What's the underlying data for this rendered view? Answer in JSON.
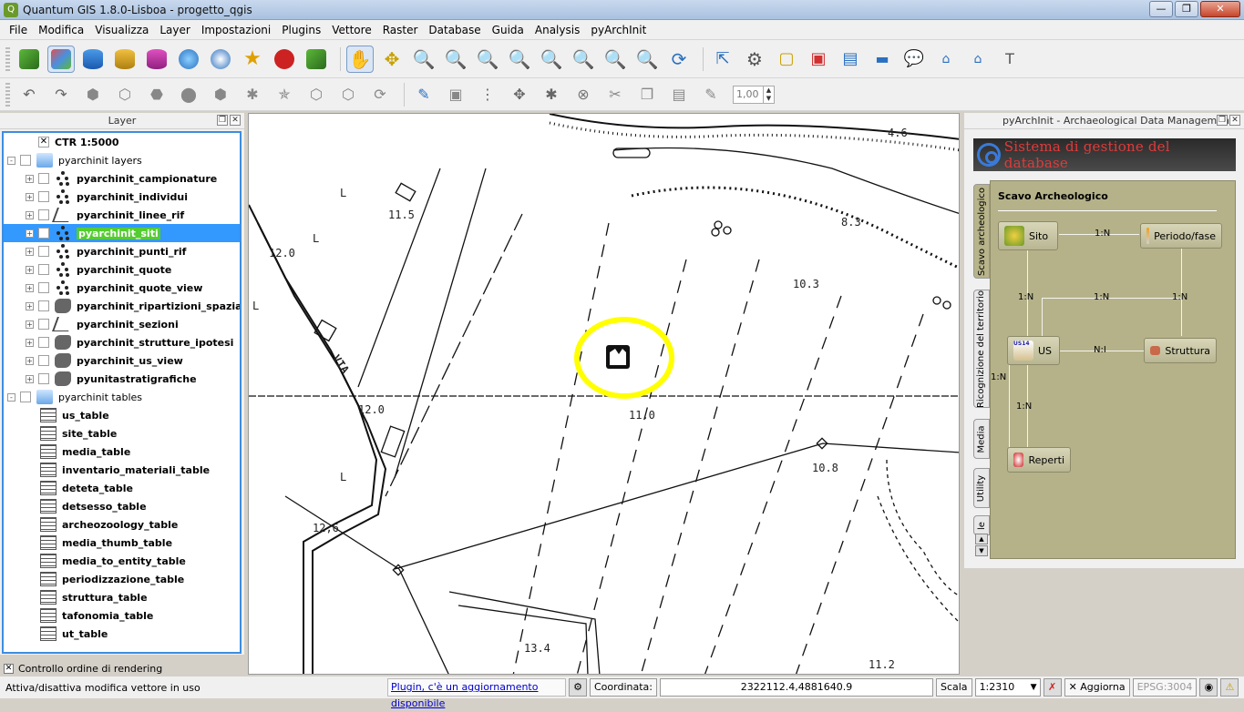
{
  "window": {
    "title": "Quantum GIS 1.8.0-Lisboa - progetto_qgis",
    "icon_label": "Q"
  },
  "menu": [
    "File",
    "Modifica",
    "Visualizza",
    "Layer",
    "Impostazioni",
    "Plugins",
    "Vettore",
    "Raster",
    "Database",
    "Guida",
    "Analysis",
    "pyArchInit"
  ],
  "layer_panel": {
    "title": "Layer",
    "rows": [
      {
        "label": "CTR 1:5000",
        "checked": true,
        "indent": 1,
        "icon": "none",
        "expander": "",
        "checkbox": true,
        "bold": true
      },
      {
        "label": "pyarchinit layers",
        "checked": false,
        "indent": 0,
        "icon": "folder",
        "expander": "-",
        "checkbox": true,
        "bold": false
      },
      {
        "label": "pyarchinit_campionature",
        "checked": false,
        "indent": 1,
        "icon": "points",
        "expander": "+",
        "checkbox": true,
        "bold": true
      },
      {
        "label": "pyarchinit_individui",
        "checked": false,
        "indent": 1,
        "icon": "points",
        "expander": "+",
        "checkbox": true,
        "bold": true
      },
      {
        "label": "pyarchinit_linee_rif",
        "checked": false,
        "indent": 1,
        "icon": "lines",
        "expander": "+",
        "checkbox": true,
        "bold": true
      },
      {
        "label": "pyarchinit_siti",
        "checked": true,
        "indent": 1,
        "icon": "points",
        "expander": "+",
        "checkbox": true,
        "bold": true,
        "selected": true
      },
      {
        "label": "pyarchinit_punti_rif",
        "checked": false,
        "indent": 1,
        "icon": "points",
        "expander": "+",
        "checkbox": true,
        "bold": true
      },
      {
        "label": "pyarchinit_quote",
        "checked": false,
        "indent": 1,
        "icon": "points",
        "expander": "+",
        "checkbox": true,
        "bold": true
      },
      {
        "label": "pyarchinit_quote_view",
        "checked": false,
        "indent": 1,
        "icon": "points",
        "expander": "+",
        "checkbox": true,
        "bold": true
      },
      {
        "label": "pyarchinit_ripartizioni_spaziali",
        "checked": false,
        "indent": 1,
        "icon": "polygon",
        "expander": "+",
        "checkbox": true,
        "bold": true
      },
      {
        "label": "pyarchinit_sezioni",
        "checked": false,
        "indent": 1,
        "icon": "lines",
        "expander": "+",
        "checkbox": true,
        "bold": true
      },
      {
        "label": "pyarchinit_strutture_ipotesi",
        "checked": false,
        "indent": 1,
        "icon": "polygon",
        "expander": "+",
        "checkbox": true,
        "bold": true
      },
      {
        "label": "pyarchinit_us_view",
        "checked": false,
        "indent": 1,
        "icon": "polygon",
        "expander": "+",
        "checkbox": true,
        "bold": true
      },
      {
        "label": "pyunitastratigrafiche",
        "checked": false,
        "indent": 1,
        "icon": "polygon",
        "expander": "+",
        "checkbox": true,
        "bold": true
      },
      {
        "label": "pyarchinit tables",
        "checked": false,
        "indent": 0,
        "icon": "folder",
        "expander": "-",
        "checkbox": true,
        "bold": false
      },
      {
        "label": "us_table",
        "indent": 2,
        "icon": "table",
        "expander": "",
        "checkbox": false,
        "bold": true
      },
      {
        "label": "site_table",
        "indent": 2,
        "icon": "table",
        "expander": "",
        "checkbox": false,
        "bold": true
      },
      {
        "label": "media_table",
        "indent": 2,
        "icon": "table",
        "expander": "",
        "checkbox": false,
        "bold": true
      },
      {
        "label": "inventario_materiali_table",
        "indent": 2,
        "icon": "table",
        "expander": "",
        "checkbox": false,
        "bold": true
      },
      {
        "label": "deteta_table",
        "indent": 2,
        "icon": "table",
        "expander": "",
        "checkbox": false,
        "bold": true
      },
      {
        "label": "detsesso_table",
        "indent": 2,
        "icon": "table",
        "expander": "",
        "checkbox": false,
        "bold": true
      },
      {
        "label": "archeozoology_table",
        "indent": 2,
        "icon": "table",
        "expander": "",
        "checkbox": false,
        "bold": true
      },
      {
        "label": "media_thumb_table",
        "indent": 2,
        "icon": "table",
        "expander": "",
        "checkbox": false,
        "bold": true
      },
      {
        "label": "media_to_entity_table",
        "indent": 2,
        "icon": "table",
        "expander": "",
        "checkbox": false,
        "bold": true
      },
      {
        "label": "periodizzazione_table",
        "indent": 2,
        "icon": "table",
        "expander": "",
        "checkbox": false,
        "bold": true
      },
      {
        "label": "struttura_table",
        "indent": 2,
        "icon": "table",
        "expander": "",
        "checkbox": false,
        "bold": true
      },
      {
        "label": "tafonomia_table",
        "indent": 2,
        "icon": "table",
        "expander": "",
        "checkbox": false,
        "bold": true
      },
      {
        "label": "ut_table",
        "indent": 2,
        "icon": "table",
        "expander": "",
        "checkbox": false,
        "bold": true
      }
    ],
    "render_order_label": "Controllo ordine di rendering"
  },
  "map_labels": [
    "4.6",
    "11.5",
    "12.0",
    "8.3",
    "10.3",
    "12.0",
    "11.0",
    "10.8",
    "12,6",
    "13.4",
    "11.2",
    "VIA",
    "L",
    "L",
    "L",
    "L"
  ],
  "toolbar": {
    "snap_value": "1,00"
  },
  "pyarchinit": {
    "title": "pyArchInit - Archaeological Data Management",
    "banner": "Sistema di gestione del database",
    "tabs": [
      "Scavo archeologico",
      "Ricognizione del territorio",
      "Media",
      "Utility",
      "le"
    ],
    "section_title": "Scavo Archeologico",
    "buttons": {
      "sito": "Sito",
      "periodo": "Periodo/fase",
      "us": "US",
      "struttura": "Struttura",
      "reperti": "Reperti"
    },
    "us_badge": "US14",
    "relations": [
      "1:N",
      "1:N",
      "1:N",
      "1:N",
      "N:I",
      "1:N",
      "1:N"
    ]
  },
  "statusbar": {
    "message": "Attiva/disattiva modifica vettore in uso",
    "plugin_link": "Plugin, c'è un aggiornamento disponibile",
    "coord_label": "Coordinata:",
    "coord_value": "2322112.4,4881640.9",
    "scale_label": "Scala",
    "scale_value": "1:2310",
    "refresh_label": "Aggiorna",
    "crs": "EPSG:3004"
  },
  "colors": {
    "selection": "#3399ff",
    "highlight": "#ffff00",
    "banner_text": "#e23a3a",
    "panel_bg": "#b5b28a"
  }
}
